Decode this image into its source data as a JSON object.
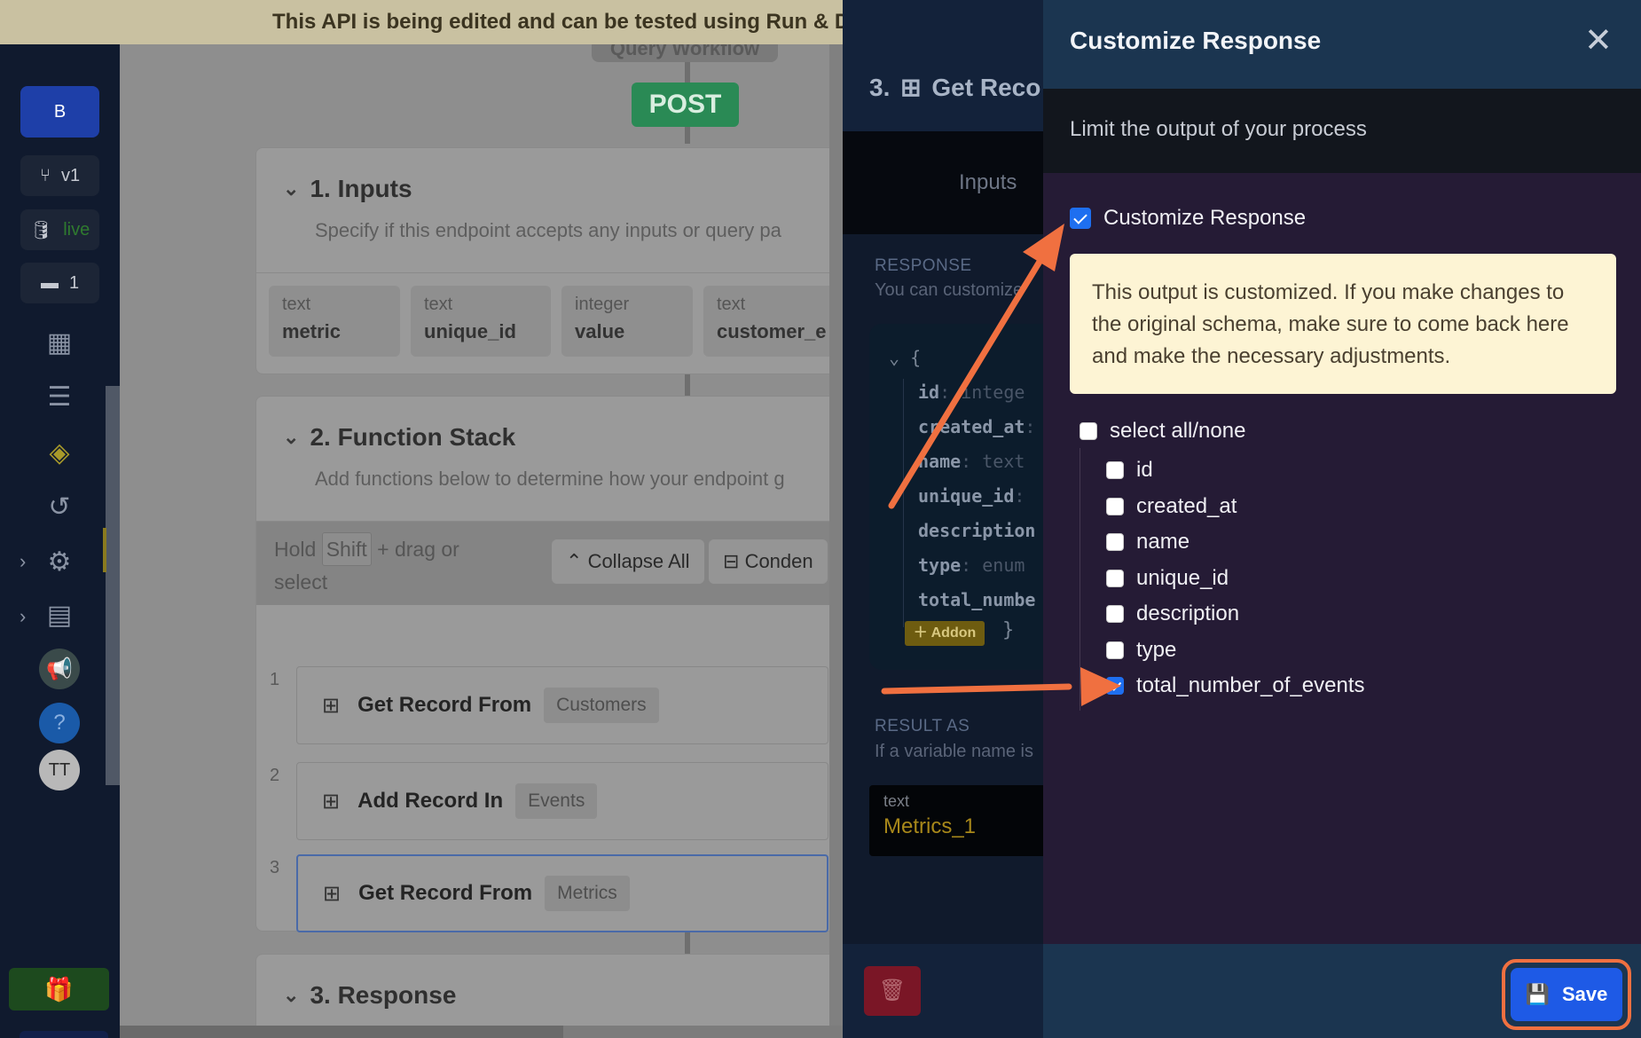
{
  "banner": {
    "text": "This API is being edited and can be tested using Run & Debug. Click 'Publis"
  },
  "leftnav": {
    "workspace": "B",
    "branch": "v1",
    "datasource": "live",
    "comments": "1",
    "avatar": "TT"
  },
  "canvas": {
    "workflow_label": "Query Workflow",
    "method": "POST",
    "inputs": {
      "title": "1. Inputs",
      "subtitle": "Specify if this endpoint accepts any inputs or query pa",
      "fields": [
        {
          "type": "text",
          "name": "metric"
        },
        {
          "type": "text",
          "name": "unique_id"
        },
        {
          "type": "integer",
          "name": "value"
        },
        {
          "type": "text",
          "name": "customer_e"
        }
      ]
    },
    "function_stack": {
      "title": "2. Function Stack",
      "subtitle": "Add functions below to determine how your endpoint g",
      "hold_prefix": "Hold",
      "hold_key": "Shift",
      "hold_suffix": "+ drag or",
      "hold_line2": "select",
      "collapse_all": "Collapse All",
      "condense": "Conden",
      "steps": [
        {
          "num": "1",
          "label": "Get Record From",
          "tag": "Customers"
        },
        {
          "num": "2",
          "label": "Add Record In",
          "tag": "Events"
        },
        {
          "num": "3",
          "label": "Get Record From",
          "tag": "Metrics"
        }
      ]
    },
    "response": {
      "title": "3. Response"
    }
  },
  "middle": {
    "title": "3.",
    "title_rest": "Get Reco",
    "tab": "Inputs",
    "response_label": "RESPONSE",
    "response_sub": "You can customize",
    "schema": [
      {
        "key": "id",
        "sep": ":",
        "type": "intege"
      },
      {
        "key": "created_at",
        "sep": ":",
        "type": ""
      },
      {
        "key": "name",
        "sep": ":",
        "type": "text"
      },
      {
        "key": "unique_id",
        "sep": ":",
        "type": ""
      },
      {
        "key": "description",
        "sep": "",
        "type": ""
      },
      {
        "key": "type",
        "sep": ":",
        "type": "enum"
      },
      {
        "key": "total_numbe",
        "sep": "",
        "type": ""
      }
    ],
    "open_brace": "{",
    "close_brace": "}",
    "addon": "Addon",
    "result_label": "RESULT AS",
    "result_sub": "If a variable name is",
    "result_type": "text",
    "result_value": "Metrics_1"
  },
  "panel": {
    "title": "Customize Response",
    "subtitle": "Limit the output of your process",
    "customize_label": "Customize Response",
    "customize_checked": true,
    "notice": "This output is customized. If you make changes to the original schema, make sure to come back here and make the necessary adjustments.",
    "select_all": "select all/none",
    "fields": [
      {
        "name": "id",
        "checked": false
      },
      {
        "name": "created_at",
        "checked": false
      },
      {
        "name": "name",
        "checked": false
      },
      {
        "name": "unique_id",
        "checked": false
      },
      {
        "name": "description",
        "checked": false
      },
      {
        "name": "type",
        "checked": false
      },
      {
        "name": "total_number_of_events",
        "checked": true
      }
    ],
    "save": "Save"
  },
  "colors": {
    "accent": "#1e5ae6",
    "annotation": "#f07040",
    "notice_bg": "#fdf4d4",
    "post": "#2a8a55"
  }
}
